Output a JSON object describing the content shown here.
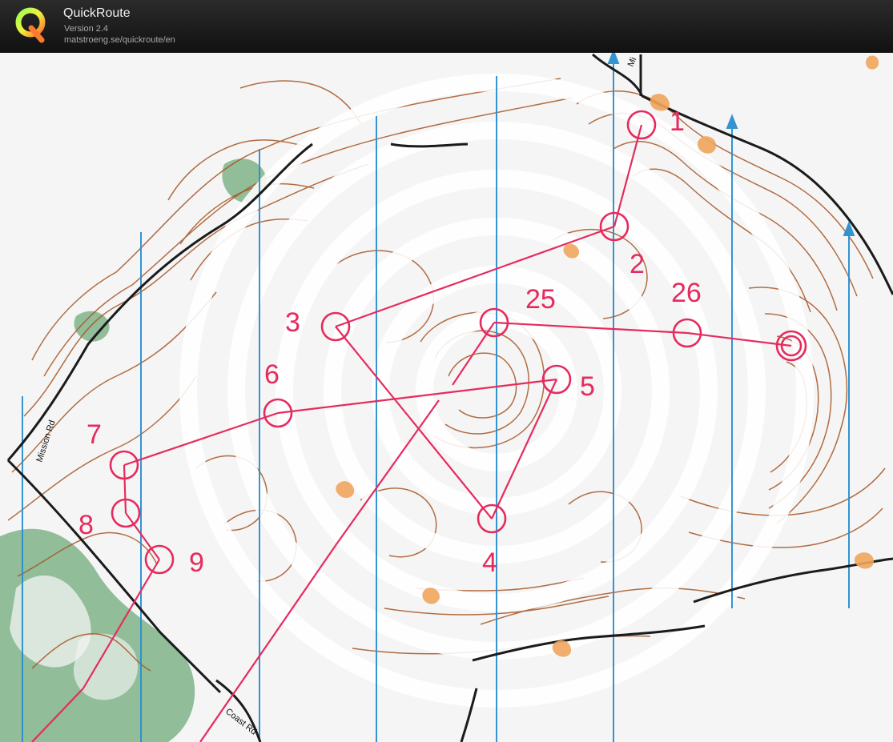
{
  "app": {
    "title": "QuickRoute",
    "version": "Version 2.4",
    "url": "matstroeng.se/quickroute/en"
  },
  "map": {
    "road_labels": {
      "mission_left": "Mission Rd",
      "mission_top": "Mi",
      "coast": "Coast Rd"
    },
    "controls": [
      "1",
      "2",
      "3",
      "4",
      "5",
      "6",
      "7",
      "8",
      "9",
      "25",
      "26"
    ]
  },
  "colors": {
    "course": "#e52b5e",
    "contour": "#a55524",
    "north_line": "#2a8fd0",
    "vegetation": "#6aa876",
    "road": "#1b1b1b"
  }
}
